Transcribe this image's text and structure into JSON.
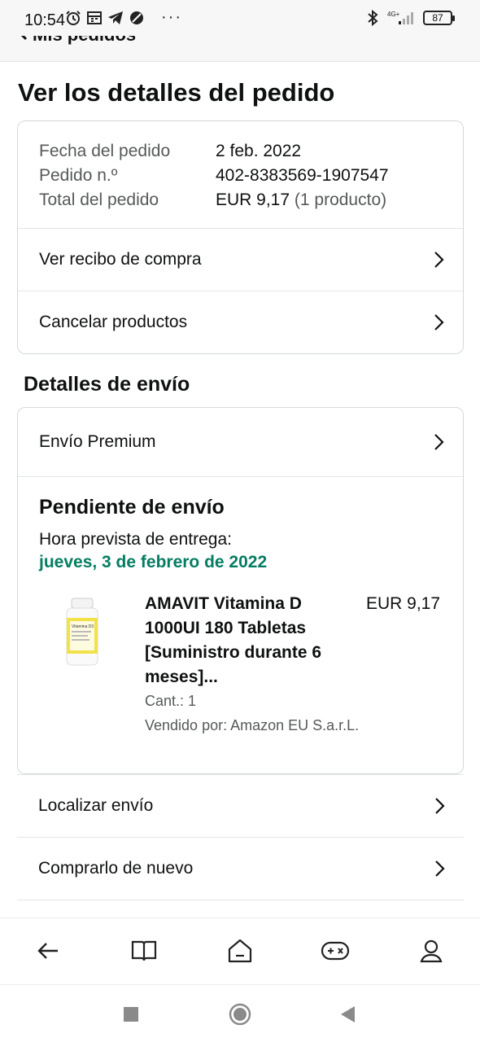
{
  "status_bar": {
    "time": "10:54",
    "dots": "···",
    "network": "4G+",
    "battery": "87"
  },
  "top_nav": {
    "back_label": "Mis pedidos"
  },
  "page_title": "Ver los detalles del pedido",
  "order_info": {
    "rows": [
      {
        "label": "Fecha del pedido",
        "value": "2 feb. 2022"
      },
      {
        "label": "Pedido n.º",
        "value": "402-8383569-1907547"
      },
      {
        "label": "Total del pedido",
        "value": "EUR 9,17",
        "extra": "(1 producto)"
      }
    ]
  },
  "actions": {
    "receipt": "Ver recibo de compra",
    "cancel": "Cancelar productos"
  },
  "shipping": {
    "section_title": "Detalles de envío",
    "method": "Envío Premium",
    "status": "Pendiente de envío",
    "eta_label": "Hora prevista de entrega:",
    "eta_date": "jueves, 3 de febrero de 2022",
    "product": {
      "name": "AMAVIT Vitamina D 1000UI 180 Tabletas [Suministro durante 6 meses]...",
      "price": "EUR 9,17",
      "qty": "Cant.: 1",
      "seller": "Vendido por: Amazon EU S.a.r.L.",
      "image_label": "Vitamina D3"
    }
  },
  "more_actions": {
    "track": "Localizar envío",
    "buy_again": "Comprarlo de nuevo"
  },
  "colors": {
    "accent_green": "#067d62",
    "border": "#d5d9d9",
    "text": "#0f1111",
    "muted": "#565959"
  },
  "bottom_nav": {
    "icons": [
      "back-arrow-icon",
      "book-icon",
      "home-icon",
      "gamepad-icon",
      "profile-icon"
    ]
  },
  "system_nav": {
    "icons": [
      "recents-icon",
      "home-circle-icon",
      "back-triangle-icon"
    ]
  }
}
